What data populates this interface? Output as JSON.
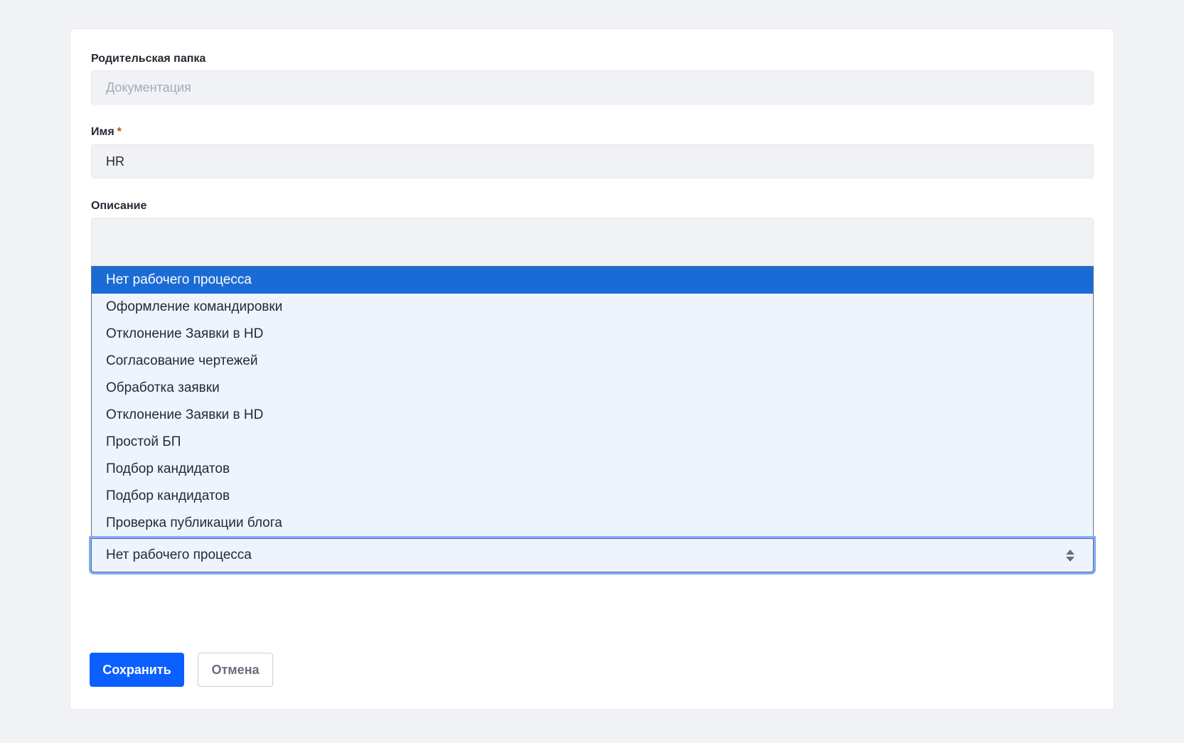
{
  "form": {
    "parent_folder": {
      "label": "Родительская папка",
      "value": "Документация"
    },
    "name": {
      "label": "Имя",
      "required_mark": "*",
      "value": "HR"
    },
    "description": {
      "label": "Описание",
      "value": ""
    },
    "workflow": {
      "selected": "Нет рабочего процесса",
      "options": [
        "Нет рабочего процесса",
        "Оформление командировки",
        "Отклонение Заявки в HD",
        "Согласование чертежей",
        "Обработка заявки",
        "Отклонение Заявки в HD",
        "Простой БП",
        "Подбор кандидатов",
        "Подбор кандидатов",
        "Проверка публикации блога"
      ]
    }
  },
  "buttons": {
    "save_label": "Сохранить",
    "cancel_label": "Отмена"
  },
  "colors": {
    "primary": "#0b5fff",
    "highlight": "#1b6bd6",
    "required": "#b95000",
    "field_bg": "#f1f2f5",
    "dropdown_bg": "#eef4fd"
  }
}
